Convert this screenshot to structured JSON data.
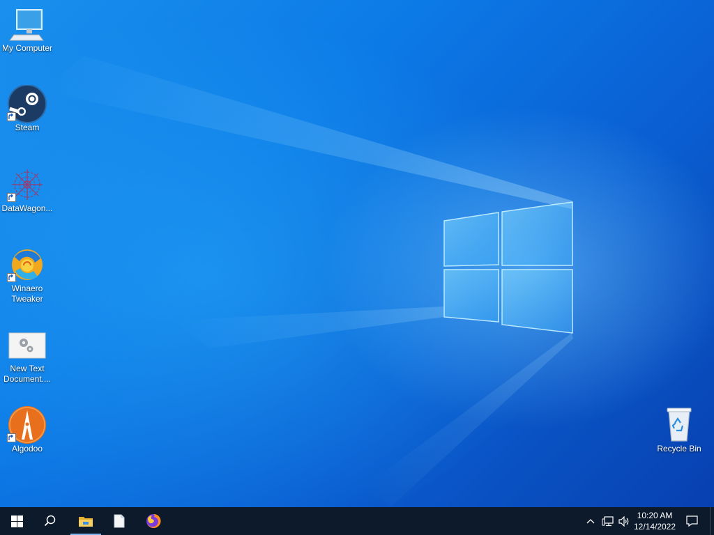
{
  "desktop": {
    "icons": [
      {
        "label": "My Computer",
        "icon": "computer-icon"
      },
      {
        "label": "Steam",
        "icon": "steam-icon"
      },
      {
        "label": "DataWagon...",
        "icon": "datawagon-icon"
      },
      {
        "label": "Winaero Tweaker",
        "icon": "winaero-tweaker-icon"
      },
      {
        "label": "New Text Document....",
        "icon": "text-document-icon"
      },
      {
        "label": "Algodoo",
        "icon": "algodoo-icon"
      },
      {
        "label": "Recycle Bin",
        "icon": "recycle-bin-icon"
      }
    ]
  },
  "taskbar": {
    "start": "windows-logo-icon",
    "search": "search-icon",
    "pinned": [
      {
        "name": "file-explorer",
        "icon": "folder-icon",
        "active": true
      },
      {
        "name": "notepad",
        "icon": "document-icon",
        "active": false
      },
      {
        "name": "firefox",
        "icon": "firefox-icon",
        "active": false
      }
    ],
    "tray": {
      "icons": [
        "chevron-up-icon",
        "network-icon",
        "volume-icon"
      ],
      "time": "10:20 AM",
      "date": "12/14/2022",
      "notifications": "notification-icon"
    }
  },
  "colors": {
    "taskbar_bg": "#0c1a2c",
    "wallpaper": "#0a64d8",
    "accent": "#7eb4ea"
  }
}
